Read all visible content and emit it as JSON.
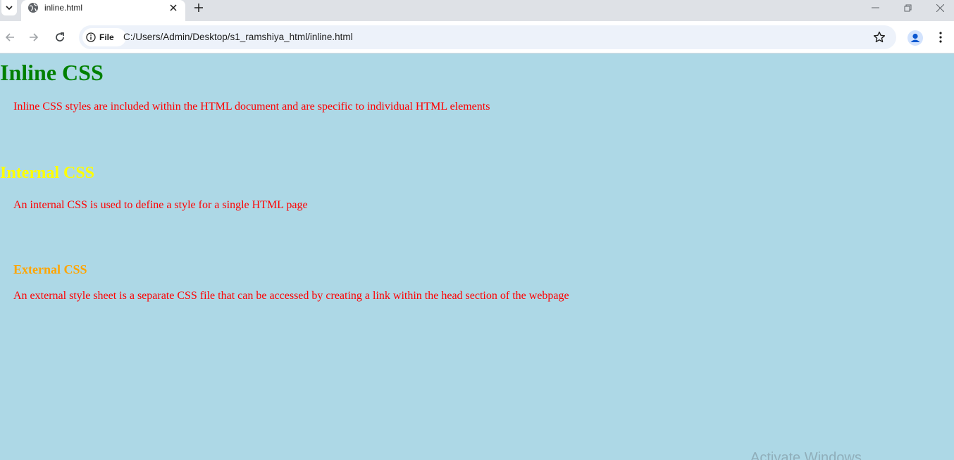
{
  "browser": {
    "tab": {
      "title": "inline.html"
    },
    "address_bar": {
      "chip_label": "File",
      "url": "C:/Users/Admin/Desktop/s1_ramshiya_html/inline.html"
    }
  },
  "page": {
    "heading_inline": "Inline CSS",
    "para_inline": "Inline CSS styles are included within the HTML document and are specific to individual HTML elements",
    "heading_internal": "Internal CSS",
    "para_internal": "An internal CSS is used to define a style for a single HTML page",
    "heading_external": "External CSS",
    "para_external": "An external style sheet is a separate CSS file that can be accessed by creating a link within the head section of the webpage",
    "background_color": "#add8e6",
    "colors": {
      "inline_heading": "#008000",
      "internal_heading": "#ffff00",
      "external_heading": "#ffa500",
      "paragraph": "#ff0000"
    }
  },
  "watermark": "Activate Windows",
  "icons": [
    "tab-search-icon",
    "globe-icon",
    "close-icon",
    "plus-icon",
    "minimize-icon",
    "restore-icon",
    "window-close-icon",
    "back-arrow-icon",
    "forward-arrow-icon",
    "reload-icon",
    "info-icon",
    "star-icon",
    "profile-icon",
    "more-vert-icon"
  ]
}
